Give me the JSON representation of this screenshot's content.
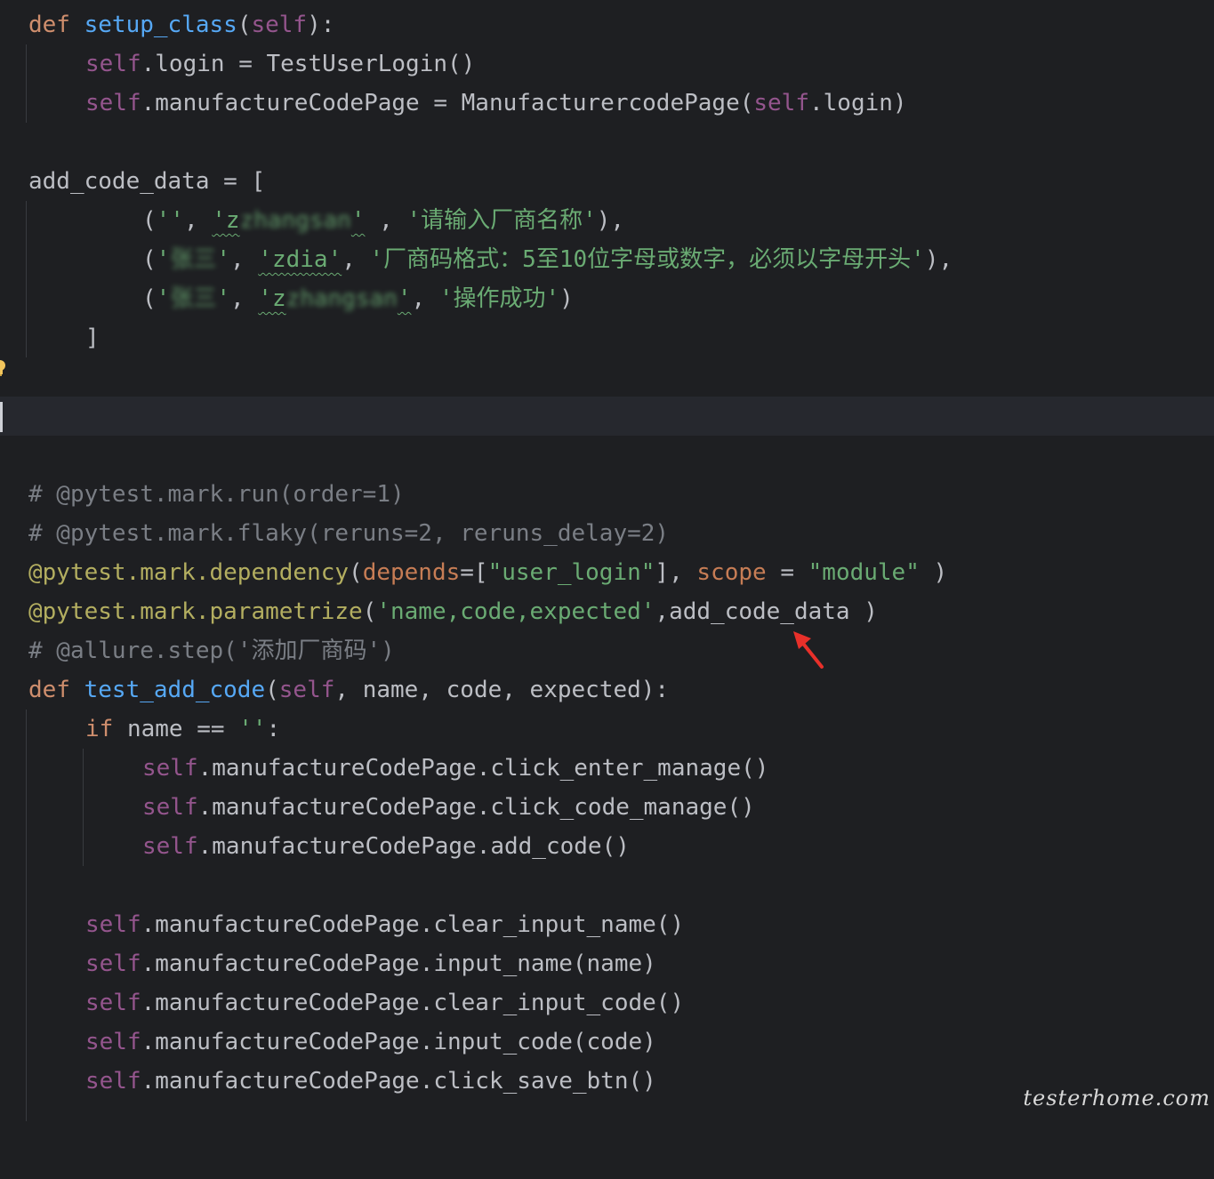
{
  "editor": {
    "theme_colors": {
      "background": "#1e1f22",
      "keyword": "#cf8e6d",
      "function": "#56a8f5",
      "self": "#94558d",
      "string": "#6aab73",
      "comment": "#7a7e85",
      "decorator": "#b3ae60",
      "text": "#bcbec4"
    },
    "lines": [
      {
        "kw_def": "def",
        "fn_name": "setup_class",
        "open": "(",
        "self": "self",
        "close": "):"
      },
      {
        "self": "self",
        "rest": ".login = TestUserLogin()"
      },
      {
        "self": "self",
        "mid": ".manufactureCodePage = ManufacturercodePage(",
        "self2": "self",
        "rest": ".login)"
      },
      {
        "text": "add_code_data = ["
      },
      {
        "p1": "(",
        "s1": "''",
        "c1": ", ",
        "s2a": "'z",
        "s2b": "zhangsan",
        "s2c": "'",
        "c2": " , ",
        "s3": "'请输入厂商名称'",
        "end": "),"
      },
      {
        "p1": "(",
        "s1a": "'",
        "s1b": "张三",
        "s1c": "'",
        "c1": ", ",
        "s2": "'zdia'",
        "c2": ", ",
        "s3": "'厂商码格式：5至10位字母或数字，必须以字母开头'",
        "end": "),"
      },
      {
        "p1": "(",
        "s1a": "'",
        "s1b": "张三",
        "s1c": "'",
        "c1": ", ",
        "s2a": "'z",
        "s2b": "zhangsan",
        "s2c": "'",
        "c2": ", ",
        "s3": "'操作成功'",
        "end": ")"
      },
      {
        "text": "]"
      },
      {
        "cmt": "# @pytest.mark.run(order=1)"
      },
      {
        "cmt": "# @pytest.mark.flaky(reruns=2, reruns_delay=2)"
      },
      {
        "deco": "@pytest.mark.dependency",
        "open": "(",
        "param1": "depends",
        "eq": "=[",
        "str1": "\"user_login\"",
        "mid": "], ",
        "param2": "scope",
        "eq2": " = ",
        "str2": "\"module\"",
        "close": " )"
      },
      {
        "deco": "@pytest.mark.parametrize",
        "open": "(",
        "str": "'name,code,expected'",
        "rest": ",add_code_data )"
      },
      {
        "cmt_a": "# @allure.step(",
        "cmt_str": "'添加厂商码'",
        "cmt_b": ")"
      },
      {
        "kw_def": "def",
        "fn_name": "test_add_code",
        "open": "(",
        "self": "self",
        "rest": ", name, code, expected):"
      },
      {
        "kw_if": "if",
        "mid": " name == ",
        "str": "''",
        "end": ":"
      },
      {
        "self": "self",
        "rest": ".manufactureCodePage.click_enter_manage()"
      },
      {
        "self": "self",
        "rest": ".manufactureCodePage.click_code_manage()"
      },
      {
        "self": "self",
        "rest": ".manufactureCodePage.add_code()"
      },
      {
        "self": "self",
        "rest": ".manufactureCodePage.clear_input_name()"
      },
      {
        "self": "self",
        "rest": ".manufactureCodePage.input_name(name)"
      },
      {
        "self": "self",
        "rest": ".manufactureCodePage.clear_input_code()"
      },
      {
        "self": "self",
        "rest": ".manufactureCodePage.input_code(code)"
      },
      {
        "self": "self",
        "rest": ".manufactureCodePage.click_save_btn()"
      }
    ]
  },
  "annotations": {
    "arrow_color": "#e8302a",
    "arrow_target": "add_code_data",
    "icon": "lightbulb-icon"
  },
  "watermark": "testerhome.com"
}
